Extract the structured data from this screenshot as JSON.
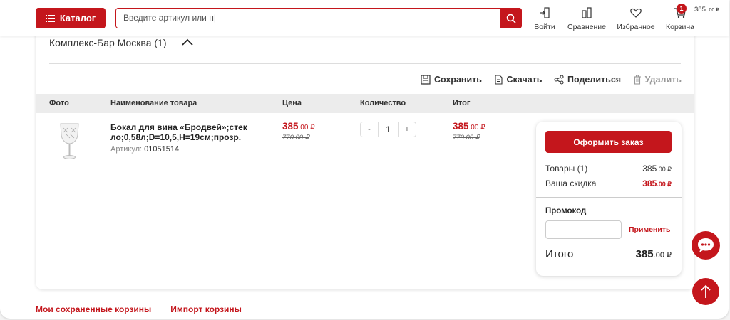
{
  "header": {
    "catalog_label": "Каталог",
    "search_placeholder": "Введите артикул или н|",
    "nav": [
      {
        "label": "Войти",
        "icon": "login-icon"
      },
      {
        "label": "Сравнение",
        "icon": "compare-icon"
      },
      {
        "label": "Избранное",
        "icon": "heart-icon"
      },
      {
        "label": "Корзина",
        "icon": "cart-icon"
      }
    ],
    "cart_count": "1",
    "cart_total": "385",
    "cart_total_cents": ".00 ₽"
  },
  "group": {
    "title": "Комплекс-Бар Москва (1)"
  },
  "actions": {
    "save": "Сохранить",
    "download": "Скачать",
    "share": "Поделиться",
    "delete": "Удалить"
  },
  "table": {
    "headers": {
      "photo": "Фото",
      "name": "Наименование товара",
      "price": "Цена",
      "qty": "Количество",
      "total": "Итог"
    },
    "rows": [
      {
        "name": "Бокал для вина «Бродвей»;стек ло;0,58л;D=10,5,H=19см;прозр.",
        "sku_label": "Артикул:",
        "sku": "01051514",
        "price": "385",
        "price_cents": ".00 ₽",
        "old_price": "770.00 ₽",
        "qty": "1",
        "minus": "-",
        "plus": "+",
        "total": "385",
        "total_cents": ".00 ₽",
        "old_total": "770.00 ₽"
      }
    ]
  },
  "summary": {
    "order_button": "Оформить заказ",
    "goods_label": "Товары (1)",
    "goods_value": "385",
    "goods_cents": ".00 ₽",
    "discount_label": "Ваша скидка",
    "discount_value": "385",
    "discount_cents": ".00 ₽",
    "promo_label": "Промокод",
    "apply_label": "Применить",
    "total_label": "Итого",
    "total_value": "385",
    "total_cents": ".00 ₽"
  },
  "footer": {
    "saved_carts": "Мои сохраненные корзины",
    "import_cart": "Импорт корзины"
  },
  "colors": {
    "accent": "#c4161c",
    "table_header_bg": "#ececec"
  }
}
